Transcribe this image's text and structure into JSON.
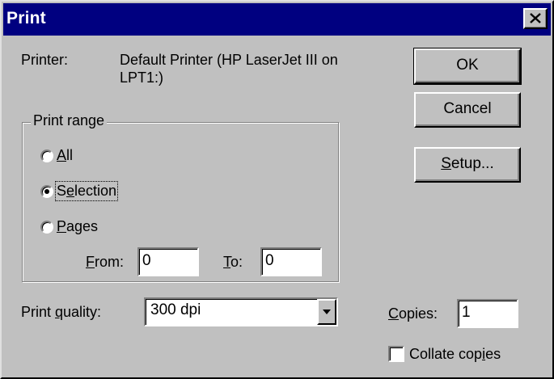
{
  "window": {
    "title": "Print",
    "close_icon": "close-icon"
  },
  "printer": {
    "label": "Printer:",
    "line1": "Default Printer (HP LaserJet III on",
    "line2": "LPT1:)"
  },
  "buttons": {
    "ok": "OK",
    "cancel": "Cancel",
    "setup_mnemonic": "S",
    "setup_rest": "etup..."
  },
  "print_range": {
    "legend": "Print range",
    "options": [
      {
        "mnemonic": "A",
        "rest": "ll",
        "selected": false
      },
      {
        "pre": "S",
        "mnemonic": "e",
        "rest": "lection",
        "selected": true
      },
      {
        "mnemonic": "P",
        "rest": "ages",
        "selected": false
      }
    ],
    "from_label_mnemonic": "F",
    "from_label_rest": "rom:",
    "from_value": "0",
    "to_label_mnemonic": "T",
    "to_label_rest": "o:",
    "to_value": "0"
  },
  "print_quality": {
    "label_pre": "Print ",
    "label_mnemonic": "q",
    "label_rest": "uality:",
    "selected": "300 dpi"
  },
  "copies": {
    "label_mnemonic": "C",
    "label_rest": "opies:",
    "value": "1"
  },
  "collate": {
    "label_pre": "Collate cop",
    "label_mnemonic": "i",
    "label_rest": "es",
    "checked": false
  },
  "colors": {
    "titlebar": "#000080",
    "face": "#c0c0c0"
  }
}
